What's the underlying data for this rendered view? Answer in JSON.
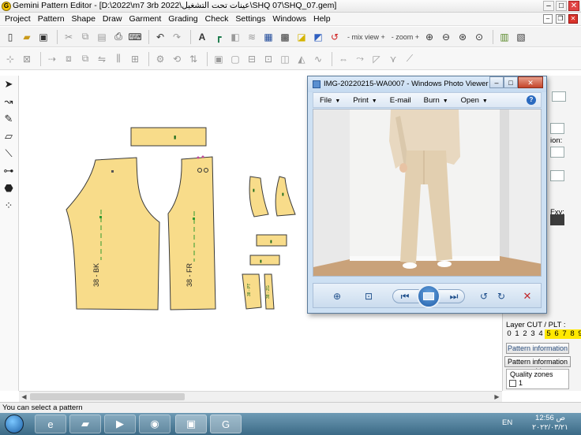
{
  "window": {
    "title": "Gemini Pattern Editor - [D:\\2022\\m7 3rb 2022\\عينات تحت التشغيل\\SHQ 07\\SHQ_07.gem]"
  },
  "menu": {
    "items": [
      "Project",
      "Pattern",
      "Shape",
      "Draw",
      "Garment",
      "Grading",
      "Check",
      "Settings",
      "Windows",
      "Help"
    ]
  },
  "toolbar": {
    "mix_view": "- mix view +",
    "zoom": "- zoom +"
  },
  "patterns": {
    "back_label": "38 - BK",
    "front_label": "38 - FR"
  },
  "colors": {
    "pattern_fill": "#f8dc8a",
    "pattern_stroke": "#3a3a3a",
    "grainline": "#2f9a2f",
    "highlight": "#ffe800",
    "taskbar": "#3b6a86"
  },
  "photo_viewer": {
    "title": "IMG-20220215-WA0007 - Windows Photo Viewer",
    "menus": [
      "File",
      "Print",
      "E-mail",
      "Burn",
      "Open"
    ],
    "help": "?"
  },
  "right_panel": {
    "label_ion": "ion:",
    "label_fxy": "Fxy:",
    "layer_title": "Layer CUT / PLT :",
    "layers": [
      {
        "n": "0",
        "on": false
      },
      {
        "n": "1",
        "on": false
      },
      {
        "n": "2",
        "on": false
      },
      {
        "n": "3",
        "on": false
      },
      {
        "n": "4",
        "on": false
      },
      {
        "n": "5",
        "on": true
      },
      {
        "n": "6",
        "on": true
      },
      {
        "n": "7",
        "on": true
      },
      {
        "n": "8",
        "on": true
      },
      {
        "n": "9",
        "on": true
      }
    ],
    "pattern_info_button": "Pattern information",
    "pattern_info_table_button": "Pattern information table",
    "quality_zones": "Quality zones",
    "quality_zone_value": "1"
  },
  "status": {
    "text": "You can select a pattern"
  },
  "taskbar": {
    "lang": "EN",
    "time": "ص 12:56",
    "date": "٢٠٢٢/٠٣/٢١"
  }
}
